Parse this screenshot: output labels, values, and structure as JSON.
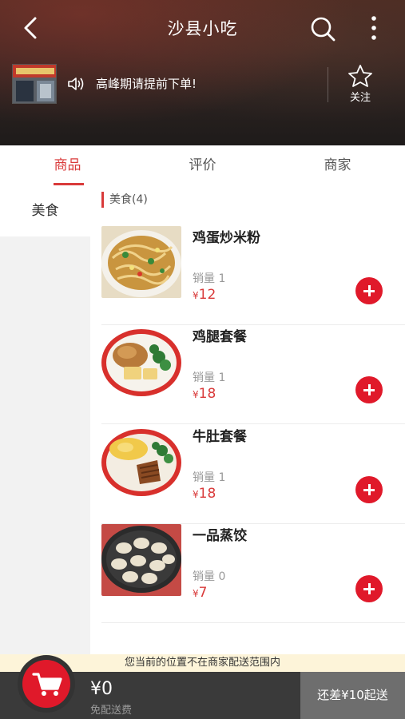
{
  "header": {
    "title": "沙县小吃",
    "notice": "高峰期请提前下单!",
    "follow_label": "关注",
    "icons": {
      "back": "chevron-left-icon",
      "search": "search-icon",
      "more": "more-vertical-icon",
      "speaker": "speaker-icon",
      "star": "star-icon"
    }
  },
  "tabs": [
    {
      "label": "商品",
      "active": true
    },
    {
      "label": "评价",
      "active": false
    },
    {
      "label": "商家",
      "active": false
    }
  ],
  "sidebar": {
    "items": [
      {
        "label": "美食",
        "active": true
      }
    ]
  },
  "section": {
    "title": "美食(4)"
  },
  "dishes": [
    {
      "name": "鸡蛋炒米粉",
      "sales": "销量 1",
      "currency": "¥",
      "price": "12"
    },
    {
      "name": "鸡腿套餐",
      "sales": "销量 1",
      "currency": "¥",
      "price": "18"
    },
    {
      "name": "牛肚套餐",
      "sales": "销量 1",
      "currency": "¥",
      "price": "18"
    },
    {
      "name": "一品蒸饺",
      "sales": "销量 0",
      "currency": "¥",
      "price": "7"
    }
  ],
  "footer": {
    "warning": "您当前的位置不在商家配送范围内",
    "total": "¥0",
    "delivery": "免配送费",
    "checkout": "还差¥10起送"
  },
  "colors": {
    "accent": "#d93a3a",
    "add_button": "#e0192a",
    "warning_bg": "#fdf4d9",
    "bottom_bar": "#3a3a3a",
    "checkout_bg": "#6e6e6e"
  }
}
